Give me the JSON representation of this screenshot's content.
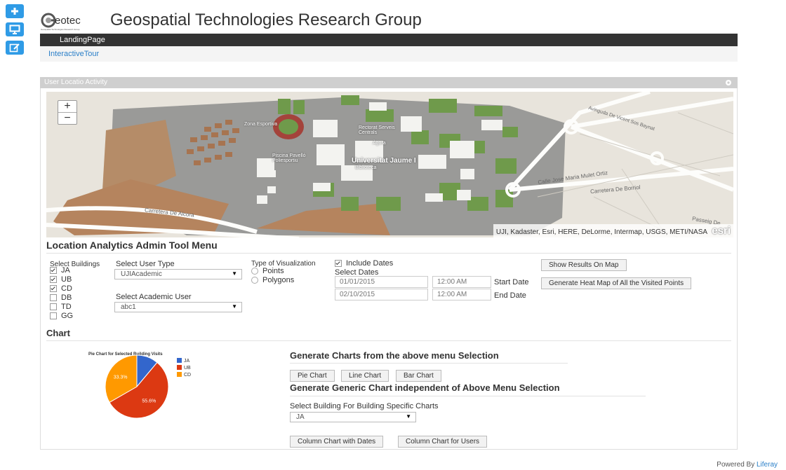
{
  "dock": {
    "icons": [
      "plus-icon",
      "monitor-icon",
      "edit-icon"
    ]
  },
  "header": {
    "logo_text": "eotec",
    "logo_sub": "Geospatial Technologies Research Group",
    "site_title": "Geospatial Technologies Research Group"
  },
  "nav": {
    "landing": "LandingPage",
    "tour": "InteractiveTour"
  },
  "portlet": {
    "title": "User Locatio Activity"
  },
  "map": {
    "zoom_in": "+",
    "zoom_out": "−",
    "attribution": "UJI, Kadaster, Esri, HERE, DeLorme, Intermap, USGS, METI/NASA",
    "esri": "esri",
    "labels": {
      "campus": "Universitat Jaume I",
      "biblioteca": "Biblioteca",
      "agora": "Àgora",
      "rectorat": "Rectorat Serveis Centrals",
      "zona_esportiva": "Zona Esportiva",
      "piscina": "Piscina Pavelló Poliesportiu",
      "road1": "Carretera De Borriol",
      "road2": "Carretera De Alcora",
      "road3": "Calle Jose Maria Mulet Ortiz",
      "road4": "Passeig De",
      "road5": "Avinguda De Vicent Sos Baynat"
    }
  },
  "menu": {
    "title": "Location Analytics Admin Tool Menu",
    "buildings_label": "Select Buildings",
    "buildings": [
      {
        "name": "JA",
        "checked": true
      },
      {
        "name": "UB",
        "checked": true
      },
      {
        "name": "CD",
        "checked": true
      },
      {
        "name": "DB",
        "checked": false
      },
      {
        "name": "TD",
        "checked": false
      },
      {
        "name": "GG",
        "checked": false
      }
    ],
    "user_type_label": "Select User Type",
    "user_type_value": "UJIAcademic",
    "academic_user_label": "Select Academic User",
    "academic_user_value": "abc1",
    "viz_label": "Type of Visualization",
    "viz_options": [
      "Points",
      "Polygons"
    ],
    "include_dates": "Include Dates",
    "select_dates": "Select Dates",
    "start_date": "01/01/2015",
    "start_time": "12:00 AM",
    "start_label": "Start Date",
    "end_date": "02/10/2015",
    "end_time": "12:00 AM",
    "end_label": "End Date",
    "show_results": "Show Results On Map",
    "heatmap": "Generate Heat Map of All the Visited Points"
  },
  "chart_section": {
    "title": "Chart",
    "gen_title": "Generate Charts from the above menu Selection",
    "buttons": [
      "Pie Chart",
      "Line Chart",
      "Bar Chart"
    ],
    "generic_title": "Generate Generic Chart independent of Above Menu Selection",
    "building_label": "Select Building For Building Specific Charts",
    "building_value": "JA",
    "col_dates": "Column Chart with Dates",
    "col_users": "Column Chart for Users"
  },
  "chart_data": {
    "type": "pie",
    "title": "Pie Chart for Selected Building Visits",
    "categories": [
      "JA",
      "UB",
      "CD"
    ],
    "values": [
      11.1,
      55.6,
      33.3
    ],
    "labels": [
      "",
      "55.6%",
      "33.3%"
    ],
    "colors": [
      "#3366cc",
      "#dc3912",
      "#ff9900"
    ],
    "legend": "right"
  },
  "footer": {
    "powered": "Powered By",
    "liferay": "Liferay"
  }
}
